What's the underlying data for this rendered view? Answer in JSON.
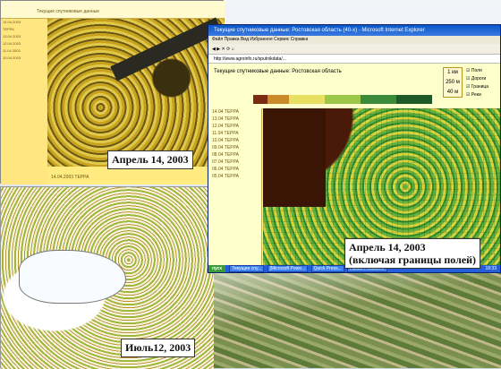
{
  "win1": {
    "caption": "Апрель 14, 2003",
    "toolbar_text": "Текущие спутниковые данные",
    "status_text": "14.04.2003 ТЕРРА",
    "left_col": [
      "14.04.2003",
      "ТЕРРА",
      "13.04.2003",
      "12.04.2003",
      "11.04.2003",
      "10.04.2003"
    ]
  },
  "win2": {
    "caption": "Июль12, 2003"
  },
  "win3": {
    "title": "Текущие спутниковые данные: Ростовская область (40-x) - Microsoft Internet Explorer",
    "menu": "Файл  Правка  Вид  Избранное  Сервис  Справка",
    "address": "http://www.agroinfo.ru/sputnikdata/...",
    "header": "Текущие спутниковые данные: Ростовская область",
    "scale": [
      "1 км",
      "250 м",
      "40 м"
    ],
    "checks": [
      "Поля",
      "Дороги",
      "Граница",
      "Реки"
    ],
    "dates": [
      {
        "d": "14.04",
        "s": "ТЕРРА"
      },
      {
        "d": "13.04",
        "s": "ТЕРРА"
      },
      {
        "d": "12.04",
        "s": "ТЕРРА"
      },
      {
        "d": "11.04",
        "s": "ТЕРРА"
      },
      {
        "d": "10.04",
        "s": "ТЕРРА"
      },
      {
        "d": "09.04",
        "s": "ТЕРРА"
      },
      {
        "d": "08.04",
        "s": "ТЕРРА"
      },
      {
        "d": "07.04",
        "s": "ТЕРРА"
      },
      {
        "d": "06.04",
        "s": "ТЕРРА"
      },
      {
        "d": "05.04",
        "s": "ТЕРРА"
      }
    ],
    "caption_line1": "Апрель 14, 2003",
    "caption_line2": "(включая границы полей)",
    "taskbar": {
      "start": "пуск",
      "tasks": [
        "Текущие спу...",
        "[Microsoft Powe...",
        "Quick Press...",
        "Adobe Photosh..."
      ],
      "clock": "18:33"
    }
  }
}
